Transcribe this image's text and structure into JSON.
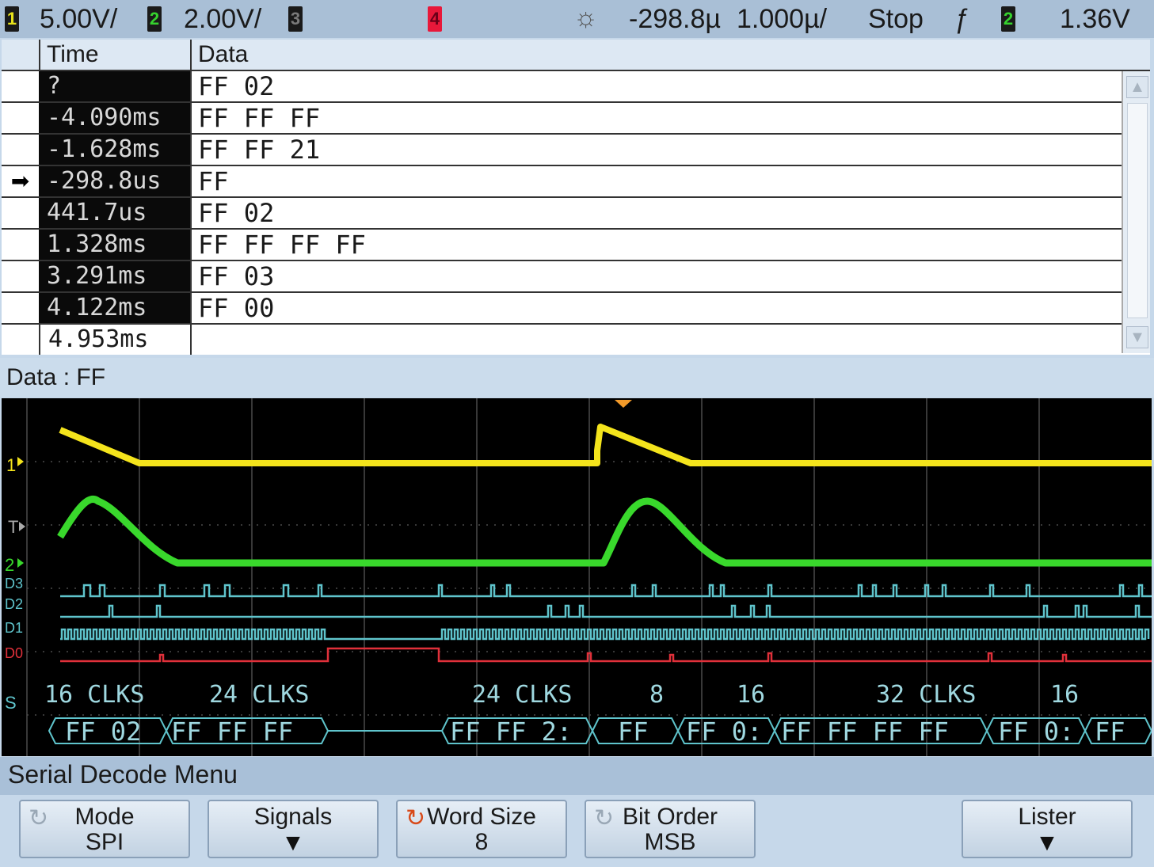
{
  "status_bar": {
    "ch1_num": "1",
    "ch1_scale": "5.00V/",
    "ch2_num": "2",
    "ch2_scale": "2.00V/",
    "ch3_num": "3",
    "ch4_num": "4",
    "trigger_icon": "sun-icon",
    "time_offset": "-298.8µ",
    "time_scale": "1.000µ/",
    "run_state": "Stop",
    "slope_icon": "ᶊ",
    "trig_source": "2",
    "trig_level": "1.36V"
  },
  "lister": {
    "col_time": "Time",
    "col_data": "Data",
    "rows": [
      {
        "marker": "",
        "time": "?",
        "data": "FF 02"
      },
      {
        "marker": "",
        "time": "-4.090ms",
        "data": "FF FF FF"
      },
      {
        "marker": "",
        "time": "-1.628ms",
        "data": "FF FF 21"
      },
      {
        "marker": "➡",
        "time": "-298.8us",
        "data": "FF"
      },
      {
        "marker": "",
        "time": "441.7us",
        "data": "FF 02"
      },
      {
        "marker": "",
        "time": "1.328ms",
        "data": "FF FF FF FF"
      },
      {
        "marker": "",
        "time": "3.291ms",
        "data": "FF 03"
      },
      {
        "marker": "",
        "time": "4.122ms",
        "data": "FF 00"
      },
      {
        "marker": "",
        "time": "4.953ms",
        "data": ""
      }
    ]
  },
  "data_label": "Data : FF",
  "scope": {
    "ch_labels": [
      "1",
      "T",
      "2",
      "D3",
      "D2",
      "D1",
      "D0",
      "S"
    ],
    "clk_labels": [
      "16 CLKS",
      "24 CLKS",
      "24 CLKS",
      "8",
      "16",
      "32 CLKS",
      "16"
    ],
    "decode_labels": [
      "FF 02",
      "FF FF FF",
      "FF FF 2:",
      "FF",
      "FF 0:",
      "FF FF FF FF",
      "FF 0:",
      "FF"
    ],
    "colors": {
      "ch1": "#f4e41c",
      "ch2": "#39d82c",
      "digital": "#5fc4cc",
      "d0": "#e0303a",
      "grid": "#555555",
      "text": "#9fd8e0"
    }
  },
  "menu": {
    "title": "Serial Decode Menu",
    "softkeys": [
      {
        "line1": "Mode",
        "line2": "SPI"
      },
      {
        "line1": "Signals",
        "line2": ""
      },
      {
        "line1": "Word Size",
        "line2": "8"
      },
      {
        "line1": "Bit Order",
        "line2": "MSB"
      },
      {
        "line1": "Lister",
        "line2": ""
      }
    ]
  }
}
